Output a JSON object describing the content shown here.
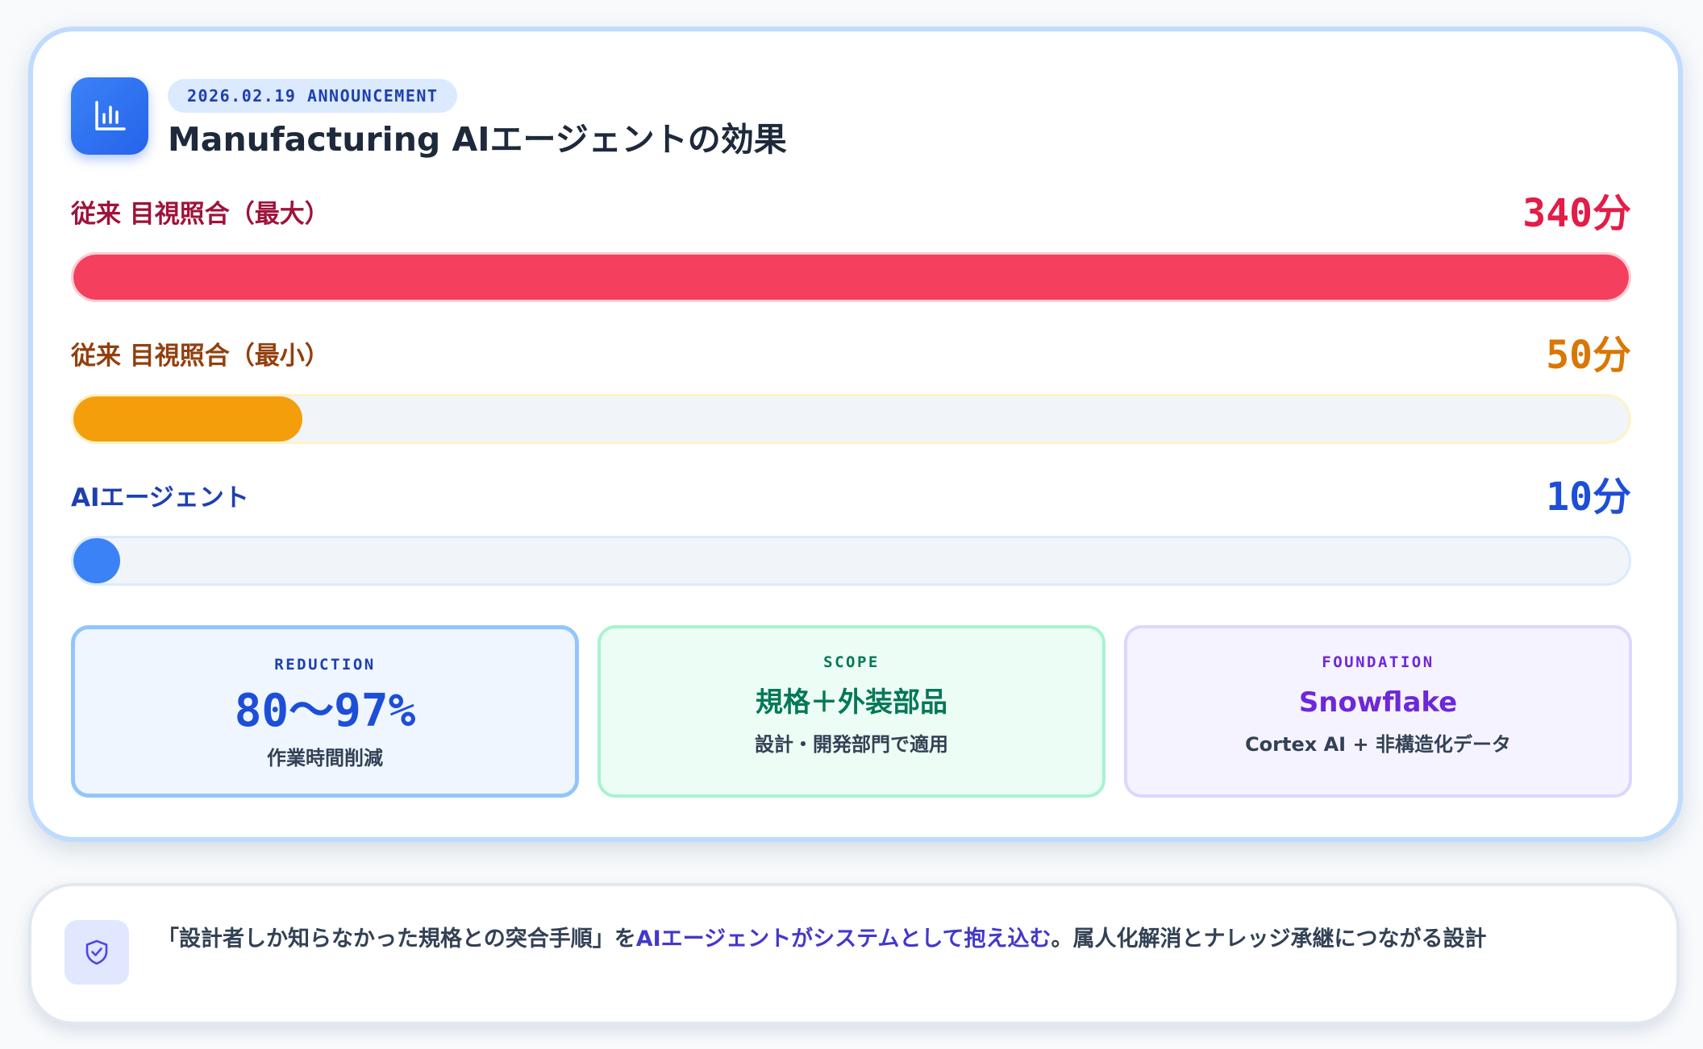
{
  "header": {
    "badge": "2026.02.19 ANNOUNCEMENT",
    "title": "Manufacturing AIエージェントの効果",
    "icon": "bar-chart-icon"
  },
  "metrics": [
    {
      "label": "従来 目視照合（最大）",
      "value": "340分",
      "minutes": 340,
      "fill_fraction": 1.0,
      "label_color": "#9f1239",
      "value_color": "#e11d48",
      "fill_color": "#f43f5e"
    },
    {
      "label": "従来 目視照合（最小）",
      "value": "50分",
      "minutes": 50,
      "fill_fraction": 0.147,
      "label_color": "#92400e",
      "value_color": "#d97706",
      "fill_color": "#f59e0b"
    },
    {
      "label": "AIエージェント",
      "value": "10分",
      "minutes": 10,
      "fill_fraction": 0.03,
      "label_color": "#1e40af",
      "value_color": "#1d4ed8",
      "fill_color": "#3b82f6"
    }
  ],
  "stats": [
    {
      "eyebrow": "REDUCTION",
      "main": "80〜97%",
      "sub": "作業時間削減",
      "accent": "#1d4ed8"
    },
    {
      "eyebrow": "SCOPE",
      "main": "規格＋外装部品",
      "sub": "設計・開発部門で適用",
      "accent": "#047857"
    },
    {
      "eyebrow": "FOUNDATION",
      "main": "Snowflake",
      "sub": "Cortex AI + 非構造化データ",
      "accent": "#6d28d9"
    }
  ],
  "note": {
    "icon": "shield-check-icon",
    "text_before": "「設計者しか知らなかった規格との突合手順」を",
    "text_highlight": "AIエージェントがシステムとして抱え込む",
    "text_after": "。属人化解消とナレッジ承継につながる設計"
  }
}
